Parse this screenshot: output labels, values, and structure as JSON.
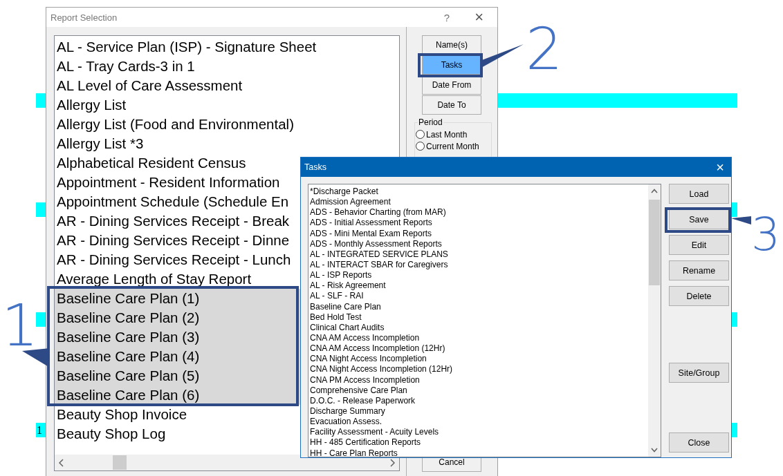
{
  "background_label": "1",
  "report_window": {
    "title": "Report Selection",
    "help": "?",
    "close": "×",
    "reports": [
      {
        "label": "AL - Service Plan (ISP) - Signature Sheet",
        "selected": false
      },
      {
        "label": "AL - Tray Cards-3 in 1",
        "selected": false
      },
      {
        "label": "AL Level of Care Assessment",
        "selected": false
      },
      {
        "label": "Allergy List",
        "selected": false
      },
      {
        "label": "Allergy List (Food and Environmental)",
        "selected": false
      },
      {
        "label": "Allergy List *3",
        "selected": false
      },
      {
        "label": "Alphabetical Resident Census",
        "selected": false
      },
      {
        "label": "Appointment - Resident Information",
        "selected": false
      },
      {
        "label": "Appointment Schedule (Schedule En",
        "selected": false
      },
      {
        "label": "AR - Dining Services Receipt - Break",
        "selected": false
      },
      {
        "label": "AR - Dining Services Receipt - Dinne",
        "selected": false
      },
      {
        "label": "AR - Dining Services Receipt - Lunch",
        "selected": false
      },
      {
        "label": "Average Length of Stay Report",
        "selected": false
      },
      {
        "label": "Baseline Care Plan (1)",
        "selected": true
      },
      {
        "label": "Baseline Care Plan (2)",
        "selected": true
      },
      {
        "label": "Baseline Care Plan (3)",
        "selected": true
      },
      {
        "label": "Baseline Care Plan (4)",
        "selected": true
      },
      {
        "label": "Baseline Care Plan (5)",
        "selected": true
      },
      {
        "label": "Baseline Care Plan (6)",
        "selected": true
      },
      {
        "label": "Beauty Shop Invoice",
        "selected": false
      },
      {
        "label": "Beauty Shop Log",
        "selected": false
      }
    ],
    "buttons": [
      {
        "label": "Name(s)",
        "selected": false
      },
      {
        "label": "Tasks",
        "selected": true
      },
      {
        "label": "Date From",
        "selected": false
      },
      {
        "label": "Date To",
        "selected": false
      }
    ],
    "period": {
      "title": "Period",
      "options": [
        {
          "label": "Last Month",
          "selected": false
        },
        {
          "label": "Current Month",
          "selected": false
        }
      ]
    },
    "cancel": "Cancel"
  },
  "tasks_dialog": {
    "title": "Tasks",
    "close": "×",
    "tasks": [
      "*Discharge Packet",
      "Admission Agreement",
      "ADS - Behavior Charting (from MAR)",
      "ADS - Initial Assessment Reports",
      "ADS - Mini Mental Exam Reports",
      "ADS - Monthly Assessment Reports",
      "AL - INTEGRATED SERVICE PLANS",
      "AL - INTERACT SBAR for Caregivers",
      "AL - ISP Reports",
      "AL - Risk Agreement",
      "AL - SLF - RAI",
      "Baseline Care Plan",
      "Bed Hold Test",
      "Clinical Chart Audits",
      "CNA AM Access Incompletion",
      "CNA AM Access Incompletion (12Hr)",
      "CNA Night Access Incompletion",
      "CNA Night Access Incompletion (12Hr)",
      "CNA PM Access Incompletion",
      "Comprehensive Care Plan",
      "D.O.C. - Release Paperwork",
      "Discharge Summary",
      "Evacuation Assess.",
      "Facility Assessment - Acuity Levels",
      "HH - 485 Certification Reports",
      "HH - Care Plan Reports"
    ],
    "buttons": [
      "Load",
      "Save",
      "Edit",
      "Rename",
      "Delete",
      "Site/Group",
      "Close"
    ]
  },
  "callouts": [
    {
      "number": "1"
    },
    {
      "number": "2"
    },
    {
      "number": "3"
    }
  ]
}
